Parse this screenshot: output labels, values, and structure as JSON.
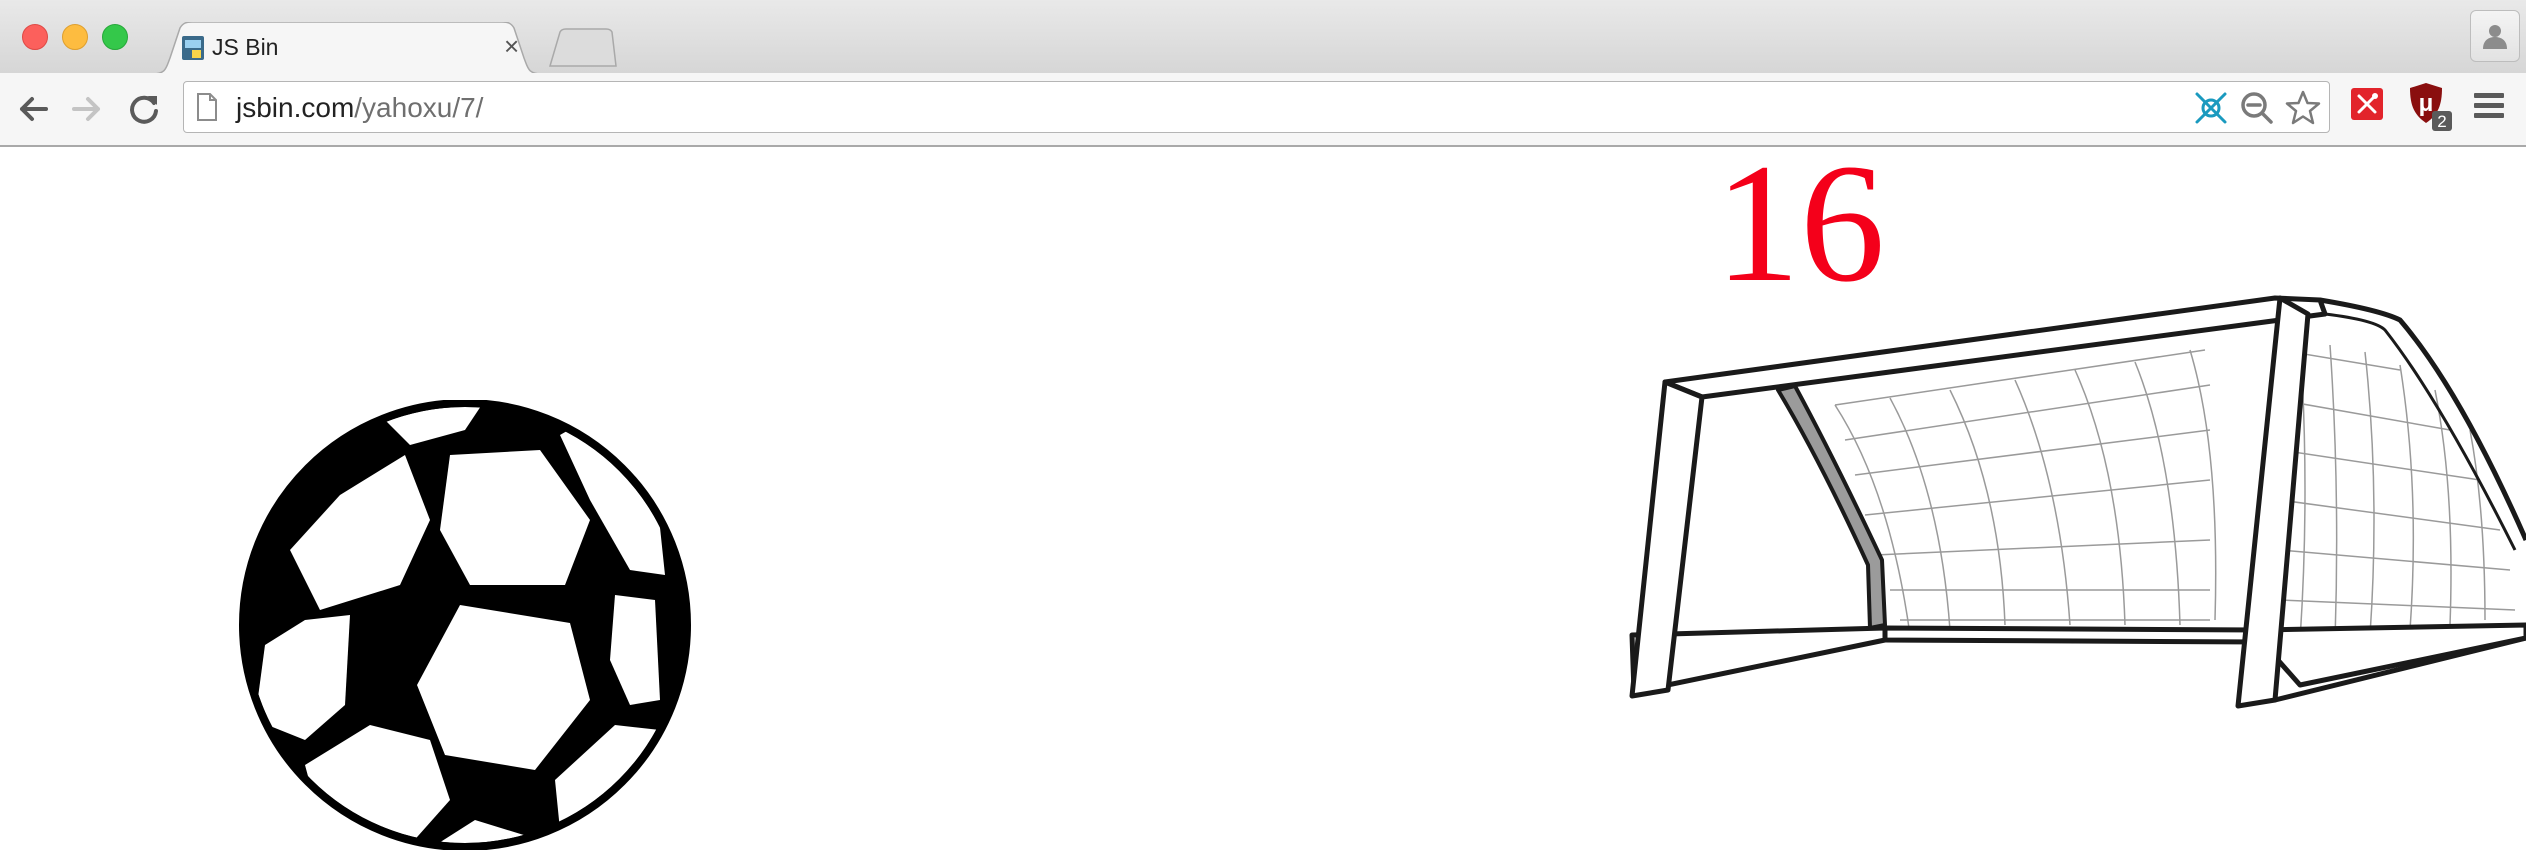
{
  "window": {
    "controls": [
      "close",
      "minimize",
      "maximize"
    ]
  },
  "tabs": [
    {
      "title": "JS Bin",
      "favicon": "jsbin-favicon",
      "active": true
    }
  ],
  "toolbar": {
    "back_icon": "arrow-left-icon",
    "forward_icon": "arrow-right-icon",
    "reload_icon": "reload-icon"
  },
  "address_bar": {
    "domain": "jsbin.com",
    "path": "/yahoxu/7/",
    "right_icons": [
      "network-icon",
      "zoom-out-icon",
      "star-icon"
    ]
  },
  "extensions": [
    {
      "name": "red-extension-icon"
    },
    {
      "name": "ublock-icon",
      "badge": "2"
    }
  ],
  "page": {
    "score": "16",
    "score_color": "#f4001a",
    "images": [
      "soccer-ball",
      "soccer-goal"
    ]
  }
}
